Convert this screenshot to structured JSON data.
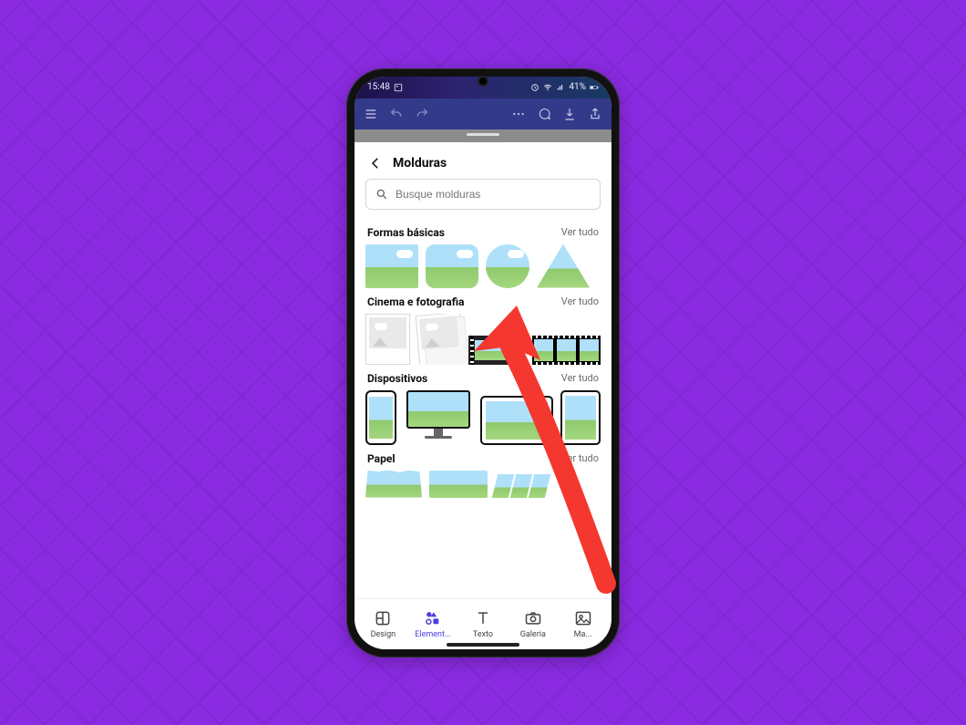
{
  "statusbar": {
    "time": "15:48",
    "battery": "41%"
  },
  "editorbar": {
    "icons": [
      "menu",
      "undo",
      "redo",
      "more",
      "comment",
      "download",
      "share"
    ]
  },
  "panel": {
    "title": "Molduras",
    "search_placeholder": "Busque molduras",
    "see_all_label": "Ver tudo",
    "sections": [
      {
        "title": "Formas básicas"
      },
      {
        "title": "Cinema e fotografia"
      },
      {
        "title": "Dispositivos"
      },
      {
        "title": "Papel"
      }
    ]
  },
  "bottom_nav": {
    "items": [
      {
        "label": "Design"
      },
      {
        "label": "Element..."
      },
      {
        "label": "Texto"
      },
      {
        "label": "Galeria"
      },
      {
        "label": "Ma..."
      }
    ],
    "active_index": 1
  },
  "colors": {
    "page_bg": "#8a2be2",
    "accent": "#4b3de0",
    "arrow": "#f4382f"
  }
}
